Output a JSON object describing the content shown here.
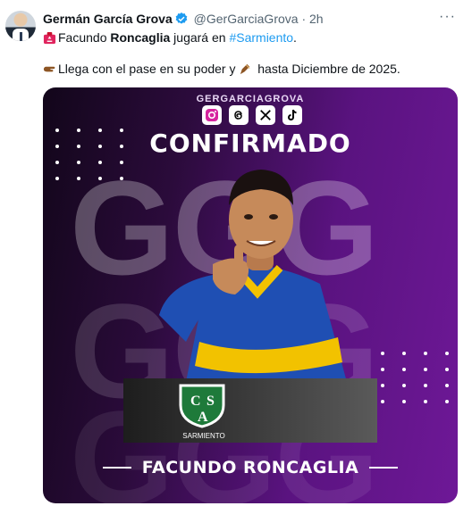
{
  "tweet": {
    "author_name": "Germán García Grova",
    "handle": "@GerGarciaGrova",
    "separator": "·",
    "time": "2h",
    "more_label": "···",
    "line1": {
      "text_a": "Facundo ",
      "bold": "Roncaglia",
      "text_b": " jugará en ",
      "hashtag": "#Sarmiento",
      "text_c": "."
    },
    "line2": {
      "text_a": "Llega con el pase en su poder y ",
      "text_b": " hasta Diciembre de 2025."
    }
  },
  "card": {
    "handle": "GERGARCIAGROVA",
    "title": "CONFIRMADO",
    "bg_letters": "GGG",
    "club_name": "SARMIENTO",
    "crest_letters": [
      "C",
      "S",
      "A"
    ],
    "player_name": "FACUNDO RONCAGLIA",
    "social_icons": [
      "instagram-icon",
      "threads-icon",
      "x-icon",
      "tiktok-icon"
    ]
  },
  "colors": {
    "accent": "#1d9bf0",
    "card_purple": "#6e1897",
    "club_green": "#1e7a3a"
  }
}
